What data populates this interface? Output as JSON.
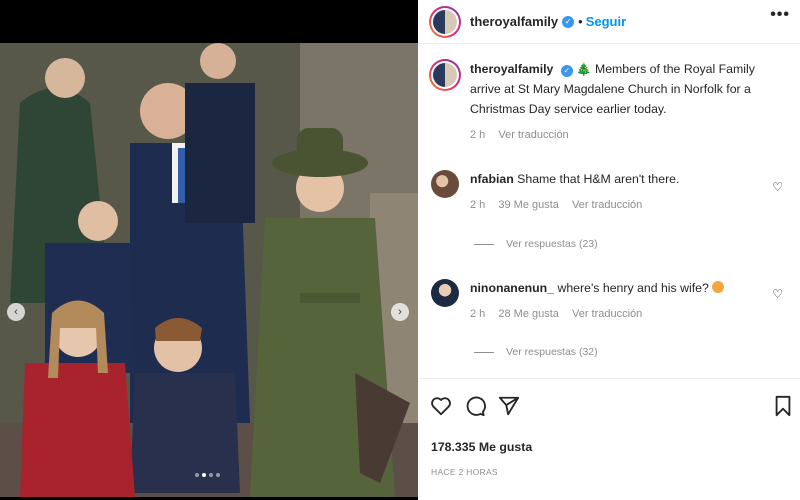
{
  "post": {
    "username": "theroyalfamily",
    "follow_label": "Seguir",
    "separator": "•",
    "more_label": "•••",
    "verified_mark": "✓",
    "caption_emoji": "🎄",
    "caption_text": "Members of the Royal Family arrive at St Mary Magdalene Church in Norfolk for a Christmas Day service earlier today.",
    "caption_time": "2 h",
    "caption_translate": "Ver traducción"
  },
  "carousel": {
    "prev_icon": "chevron-left-icon",
    "next_icon": "chevron-right-icon",
    "prev_glyph": "‹",
    "next_glyph": "›",
    "dots": 4,
    "active_dot": 2
  },
  "comments": [
    {
      "username": "nfabian",
      "text": "Shame that H&M aren't there.",
      "time": "2 h",
      "likes": "39 Me gusta",
      "translate": "Ver traducción",
      "replies": "Ver respuestas (23)"
    },
    {
      "username": "ninonanenun_",
      "text": "where's henry and his wife?",
      "time": "2 h",
      "likes": "28 Me gusta",
      "translate": "Ver traducción",
      "replies": "Ver respuestas (32)"
    }
  ],
  "footer": {
    "likes_count": "178.335 Me gusta",
    "posted_ago": "HACE 2 HORAS"
  },
  "icons": {
    "like": "heart-icon",
    "comment": "comment-icon",
    "share": "share-icon",
    "save": "bookmark-icon"
  }
}
